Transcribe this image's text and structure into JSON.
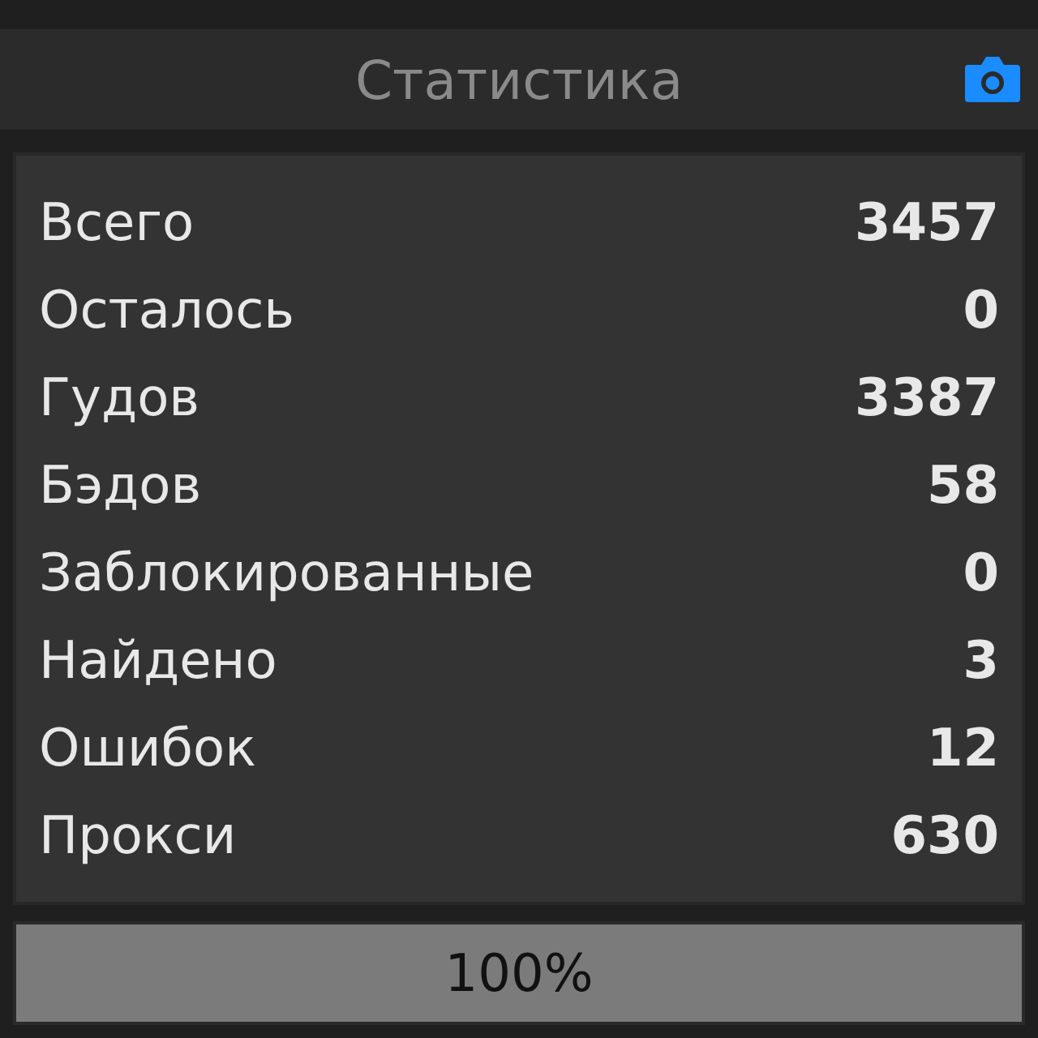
{
  "header": {
    "title": "Статистика"
  },
  "stats": [
    {
      "label": "Всего",
      "value": "3457"
    },
    {
      "label": "Осталось",
      "value": "0"
    },
    {
      "label": "Гудов",
      "value": "3387"
    },
    {
      "label": "Бэдов",
      "value": "58"
    },
    {
      "label": "Заблокированные",
      "value": "0"
    },
    {
      "label": "Найдено",
      "value": "3"
    },
    {
      "label": "Ошибок",
      "value": "12"
    },
    {
      "label": "Прокси",
      "value": "630"
    }
  ],
  "progress": {
    "level": 1,
    "text": "100%"
  }
}
